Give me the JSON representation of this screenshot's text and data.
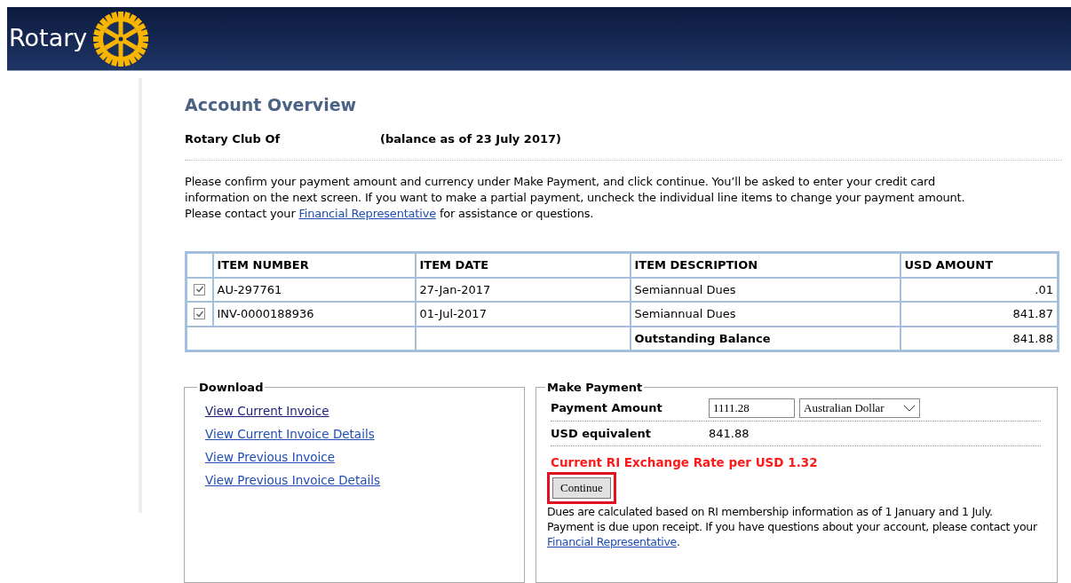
{
  "header": {
    "logo_text": "Rotary"
  },
  "title": "Account Overview",
  "club": {
    "name": "Rotary Club Of",
    "balance_note": "(balance as of 23 July 2017)"
  },
  "intro": {
    "before": "Please confirm your payment amount and currency under Make Payment, and click continue. You’ll be asked to enter your credit card information on the next screen. If you want to make a partial payment, uncheck the individual line items to change your payment amount. Please contact your ",
    "link": "Financial Representative",
    "after": " for assistance or questions."
  },
  "table": {
    "columns": [
      "ITEM NUMBER",
      "ITEM DATE",
      "ITEM DESCRIPTION",
      "USD AMOUNT"
    ],
    "rows": [
      {
        "checked": true,
        "cells": [
          "AU-297761",
          "27-Jan-2017",
          "Semiannual Dues",
          ".01"
        ]
      },
      {
        "checked": true,
        "cells": [
          "INV-0000188936",
          "01-Jul-2017",
          "Semiannual Dues",
          "841.87"
        ]
      }
    ],
    "total": {
      "label": "Outstanding Balance",
      "amount": "841.88"
    }
  },
  "download": {
    "legend": "Download",
    "links": [
      {
        "label": "View Current Invoice",
        "visited": true
      },
      {
        "label": "View Current Invoice Details",
        "visited": false
      },
      {
        "label": "View Previous Invoice",
        "visited": false
      },
      {
        "label": "View Previous Invoice Details",
        "visited": false
      }
    ]
  },
  "payment": {
    "legend": "Make Payment",
    "amount_label": "Payment Amount",
    "amount_value": "1111.28",
    "currency": "Australian Dollar",
    "usd_label": "USD equivalent",
    "usd_value": "841.88",
    "rate_note": "Current RI Exchange Rate per USD 1.32",
    "button": "Continue",
    "button_highlighted": true,
    "note": {
      "before": "Dues are calculated based on RI membership information as of 1 January and 1 July. Payment is due upon receipt. If you have questions about your account, please contact your ",
      "link": "Financial Representative",
      "after": "."
    }
  }
}
